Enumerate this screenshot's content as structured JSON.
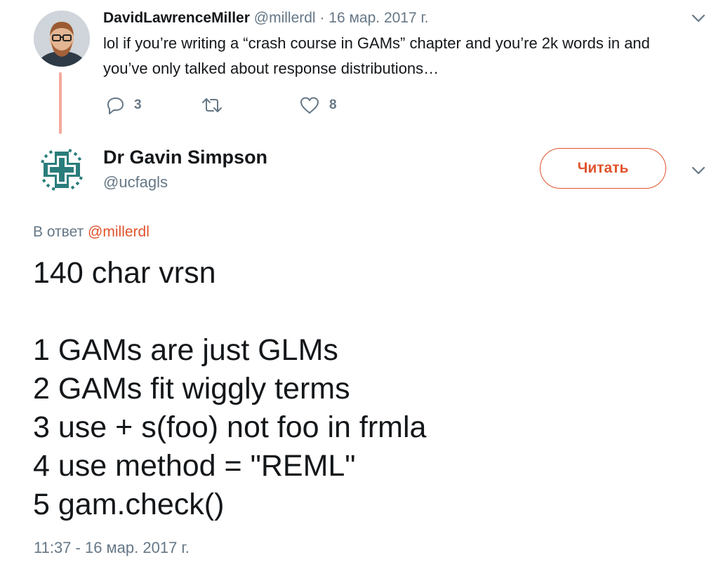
{
  "parent_tweet": {
    "display_name": "DavidLawrenceMiller",
    "handle": "@millerdl",
    "separator": "·",
    "date": "16 мар. 2017 г.",
    "text_line_1": "lol if you’re writing a “crash course in GAMs” chapter and you’re 2k words in and",
    "text_line_2": "you’ve only talked about response distributions…",
    "reply_icon": "reply-icon",
    "reply_count": "3",
    "retweet_icon": "retweet-icon",
    "like_icon": "heart-icon",
    "like_count": "8"
  },
  "main_tweet": {
    "display_name": "Dr Gavin Simpson",
    "handle": "@ucfagls",
    "follow_label": "Читать",
    "reply_prefix": "В ответ",
    "reply_to": "@millerdl",
    "lines": [
      "140 char vrsn",
      "",
      "1 GAMs are just GLMs",
      "2 GAMs fit wiggly terms",
      "3 use + s(foo) not foo in frmla",
      "4 use method = \"REML\"",
      "5 gam.check()"
    ],
    "timestamp": "11:37 - 16 мар. 2017 г."
  },
  "colors": {
    "accent": "#e0532c",
    "thread_line": "#f4a99d",
    "muted_text": "#657786",
    "main_text": "#14171a",
    "logo_teal": "#2a7d7b"
  }
}
